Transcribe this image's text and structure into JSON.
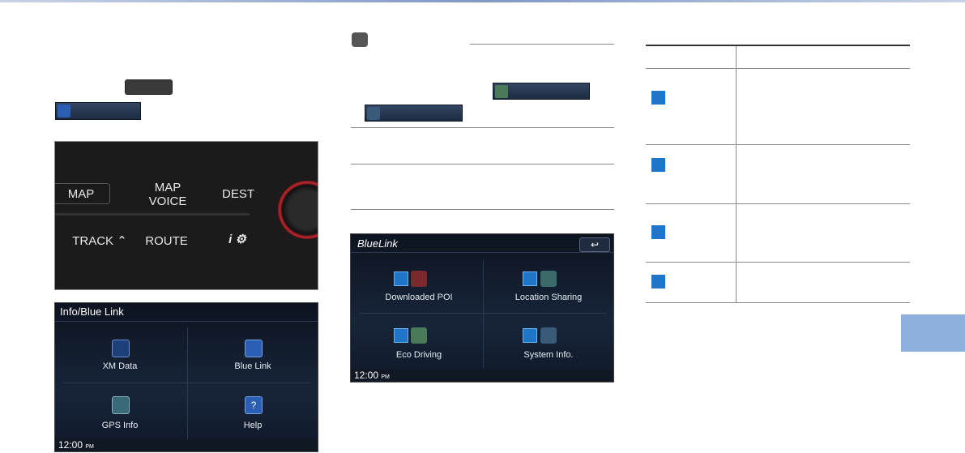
{
  "left_panel": {
    "console_buttons": {
      "map": "MAP",
      "map_voice": "MAP\nVOICE",
      "dest": "DEST",
      "track": "TRACK",
      "route": "ROUTE"
    },
    "info_screen": {
      "title": "Info/Blue Link",
      "items": [
        "XM Data",
        "Blue Link",
        "GPS Info",
        "Help"
      ],
      "clock_time": "12:00",
      "clock_ampm": "PM"
    }
  },
  "middle_panel": {
    "bluelink_screen": {
      "logo": "BlueLink",
      "items": [
        "Downloaded POI",
        "Location Sharing",
        "Eco Driving",
        "System Info."
      ],
      "clock_time": "12:00",
      "clock_ampm": "PM"
    }
  },
  "colors": {
    "accent_blue": "#1f76c8",
    "side_tab": "#8fb0dd"
  }
}
